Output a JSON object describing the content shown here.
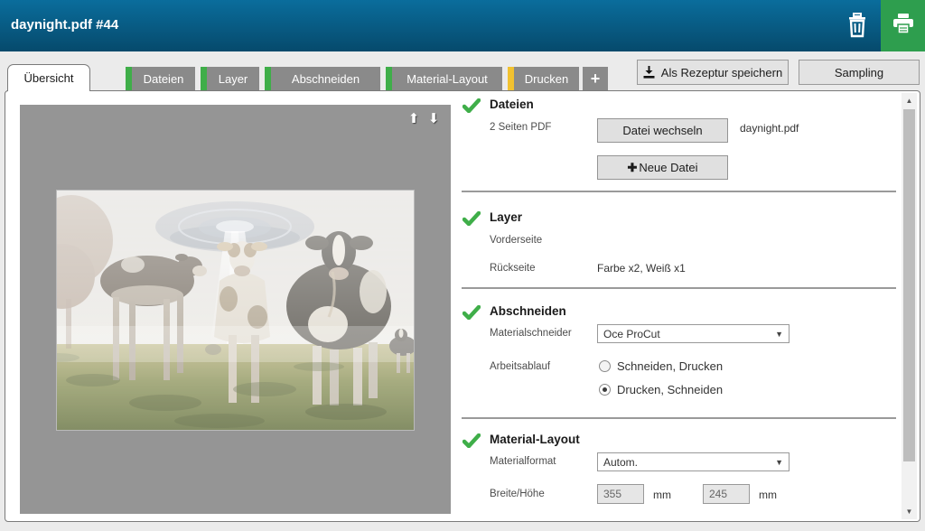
{
  "titlebar": {
    "title": "daynight.pdf #44"
  },
  "tabs": {
    "items": [
      {
        "label": "Übersicht",
        "state": "active"
      },
      {
        "label": "Dateien",
        "indicator": "green"
      },
      {
        "label": "Layer",
        "indicator": "green"
      },
      {
        "label": "Abschneiden",
        "indicator": "green"
      },
      {
        "label": "Material-Layout",
        "indicator": "green"
      },
      {
        "label": "Drucken",
        "indicator": "yellow"
      }
    ],
    "add_label": "+"
  },
  "actions": {
    "save_recipe": "Als Rezeptur speichern",
    "sampling": "Sampling"
  },
  "sections": {
    "dateien": {
      "title": "Dateien",
      "pages_label": "2 Seiten PDF",
      "change_file_button": "Datei wechseln",
      "filename": "daynight.pdf",
      "new_file_button": "Neue Datei"
    },
    "layer": {
      "title": "Layer",
      "front_label": "Vorderseite",
      "back_label": "Rückseite",
      "back_value": "Farbe x2, Weiß x1"
    },
    "abschneiden": {
      "title": "Abschneiden",
      "cutter_label": "Materialschneider",
      "cutter_value": "Oce ProCut",
      "workflow_label": "Arbeitsablauf",
      "options": [
        "Schneiden, Drucken",
        "Drucken, Schneiden"
      ],
      "selected_option": "Drucken, Schneiden"
    },
    "material_layout": {
      "title": "Material-Layout",
      "format_label": "Materialformat",
      "format_value": "Autom.",
      "size_label": "Breite/Höhe",
      "width_value": "355",
      "height_value": "245",
      "unit_width": "mm",
      "unit_height": "mm"
    }
  },
  "icons": {
    "new_file_plus": "✚",
    "caret_down": "▼",
    "page_up": "⬆",
    "page_down": "⬇",
    "scroll_up": "▲",
    "scroll_down": "▼"
  },
  "colors": {
    "header_top": "#0a6d9c",
    "header_bottom": "#064a6c",
    "status_green": "#3fae49",
    "status_yellow": "#f2c230",
    "print_button_green": "#2e9e4e",
    "tab_gray": "#8a8a8a"
  }
}
